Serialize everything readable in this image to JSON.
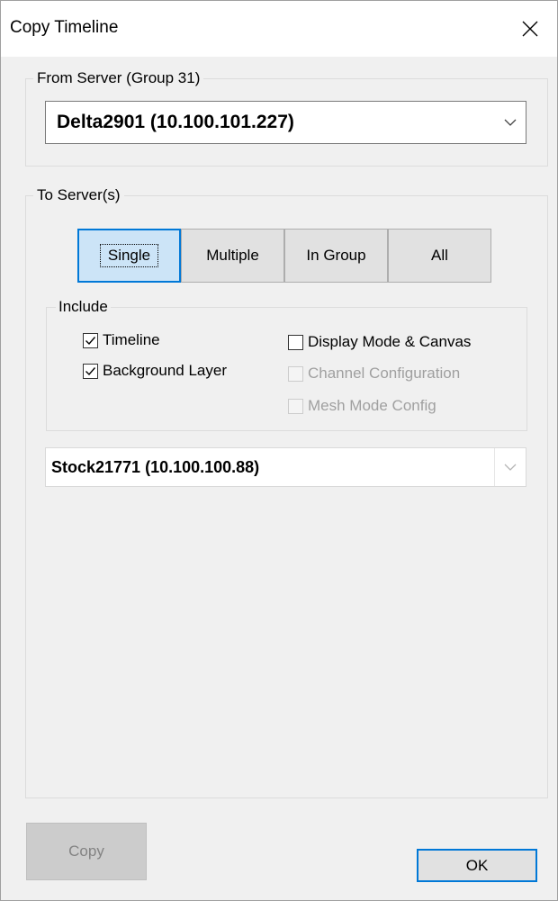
{
  "window": {
    "title": "Copy Timeline"
  },
  "from_server": {
    "legend": "From Server  (Group 31)",
    "selected": "Delta2901  (10.100.101.227)"
  },
  "to_servers": {
    "legend": "To Server(s)",
    "modes": [
      {
        "label": "Single",
        "active": true
      },
      {
        "label": "Multiple",
        "active": false
      },
      {
        "label": "In Group",
        "active": false
      },
      {
        "label": "All",
        "active": false
      }
    ],
    "include": {
      "legend": "Include",
      "options": [
        {
          "label": "Timeline",
          "checked": true,
          "enabled": true
        },
        {
          "label": "Background Layer",
          "checked": true,
          "enabled": true
        },
        {
          "label": "Display Mode & Canvas",
          "checked": false,
          "enabled": true
        },
        {
          "label": "Channel Configuration",
          "checked": false,
          "enabled": false
        },
        {
          "label": "Mesh Mode Config",
          "checked": false,
          "enabled": false
        }
      ]
    },
    "target": {
      "selected": "Stock21771  (10.100.100.88)"
    }
  },
  "buttons": {
    "copy": "Copy",
    "ok": "OK"
  },
  "colors": {
    "accent": "#0078d7",
    "active_bg": "#cce4f7",
    "disabled_text": "#a0a0a0"
  }
}
